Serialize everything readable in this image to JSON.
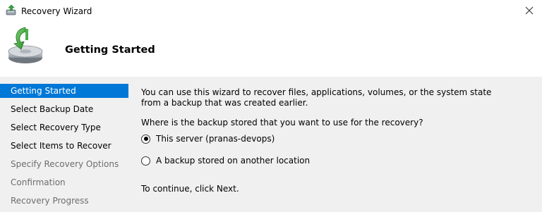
{
  "window": {
    "title": "Recovery Wizard",
    "close_icon": "close-icon",
    "app_icon": "backup-icon"
  },
  "header": {
    "title": "Getting Started",
    "icon": "recovery-disk-icon"
  },
  "steps": [
    {
      "label": "Getting Started",
      "state": "active"
    },
    {
      "label": "Select Backup Date",
      "state": "enabled"
    },
    {
      "label": "Select Recovery Type",
      "state": "enabled"
    },
    {
      "label": "Select Items to Recover",
      "state": "enabled"
    },
    {
      "label": "Specify Recovery Options",
      "state": "disabled"
    },
    {
      "label": "Confirmation",
      "state": "disabled"
    },
    {
      "label": "Recovery Progress",
      "state": "disabled"
    }
  ],
  "content": {
    "intro_line1": "You can use this wizard to recover files, applications, volumes, or the system state",
    "intro_line2": "from a backup that was created earlier.",
    "question": "Where is the backup stored that you want to use for the recovery?",
    "options": [
      {
        "label": "This server (pranas-devops)",
        "checked": true
      },
      {
        "label": "A backup stored on another location",
        "checked": false
      }
    ],
    "continue_text": "To continue, click Next."
  },
  "colors": {
    "accent": "#0078d7",
    "disabled_text": "#6d6d6d",
    "panel_bg": "#f0f0f0",
    "header_bg": "#ffffff"
  }
}
